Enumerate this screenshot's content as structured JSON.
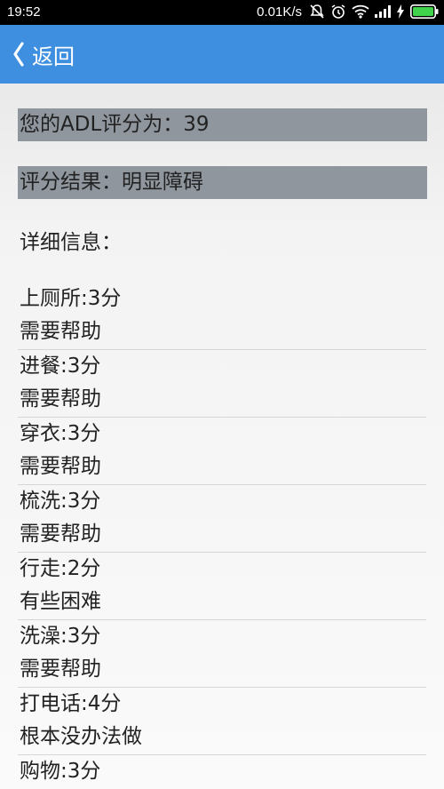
{
  "status_bar": {
    "time": "19:52",
    "network_speed": "0.01K/s",
    "icons": [
      "mute-icon",
      "alarm-icon",
      "wifi-icon",
      "signal-icon",
      "charging-icon",
      "battery-icon"
    ]
  },
  "app_bar": {
    "back_label": "返回",
    "color": "#3f8fe0"
  },
  "summary": {
    "score_text": "您的ADL评分为：39",
    "result_text": "评分结果：明显障碍",
    "detail_heading": "详细信息："
  },
  "items": [
    {
      "score": "上厕所:3分",
      "status": "需要帮助"
    },
    {
      "score": "进餐:3分",
      "status": "需要帮助"
    },
    {
      "score": "穿衣:3分",
      "status": "需要帮助"
    },
    {
      "score": "梳洗:3分",
      "status": "需要帮助"
    },
    {
      "score": "行走:2分",
      "status": "有些困难"
    },
    {
      "score": "洗澡:3分",
      "status": "需要帮助"
    },
    {
      "score": "打电话:4分",
      "status": "根本没办法做"
    },
    {
      "score": "购物:3分",
      "status": ""
    }
  ]
}
